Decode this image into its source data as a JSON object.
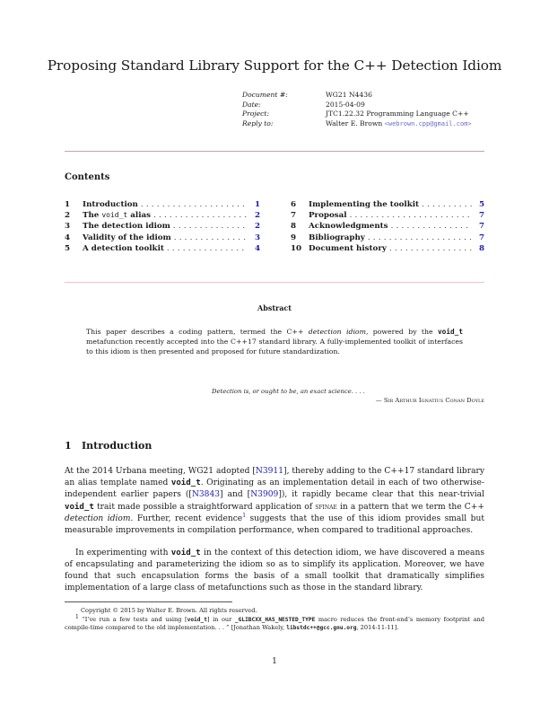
{
  "title": "Proposing Standard Library Support for the C++ Detection Idiom",
  "meta": [
    {
      "key": "Document #:",
      "value": "WG21 N4436"
    },
    {
      "key": "Date:",
      "value": "2015-04-09"
    },
    {
      "key": "Project:",
      "value": "JTC1.22.32 Programming Language C++"
    },
    {
      "key": "Reply to:",
      "value": "Walter E. Brown",
      "email": "<webrown.cpp@gmail.com>"
    }
  ],
  "contents": {
    "heading": "Contents",
    "left": [
      {
        "num": "1",
        "label": "Introduction",
        "page": "1"
      },
      {
        "num": "2",
        "label_pre": "The ",
        "label_code": "void_t",
        "label_post": " alias",
        "page": "2"
      },
      {
        "num": "3",
        "label": "The detection idiom",
        "page": "2"
      },
      {
        "num": "4",
        "label": "Validity of the idiom",
        "page": "3"
      },
      {
        "num": "5",
        "label": "A detection toolkit",
        "page": "4"
      }
    ],
    "right": [
      {
        "num": "6",
        "label": "Implementing the toolkit",
        "page": "5"
      },
      {
        "num": "7",
        "label": "Proposal",
        "page": "7"
      },
      {
        "num": "8",
        "label": "Acknowledgments",
        "page": "7"
      },
      {
        "num": "9",
        "label": "Bibliography",
        "page": "7"
      },
      {
        "num": "10",
        "label": "Document history",
        "page": "8"
      }
    ],
    "dots": "......................................"
  },
  "abstract": {
    "heading": "Abstract",
    "t1": "This paper describes a coding pattern, termed the C++ ",
    "t1_em": "detection idiom",
    "t2": ", powered by the ",
    "t2_code": "void_t",
    "t3": " metafunction recently accepted into the C++17 standard library. A fully-implemented toolkit of interfaces to this idiom is then presented and proposed for future standardization."
  },
  "epigraph": {
    "quote": "Detection is, or ought to be, an exact science. . . .",
    "attribution": "— Sir Arthur Ignatius Conan Doyle"
  },
  "section1": {
    "number": "1",
    "heading": "Introduction",
    "p1": {
      "a": "At the 2014 Urbana meeting, WG21 adopted [",
      "ref1": "N3911",
      "b": "], thereby adding to the C++17 standard library an alias template named ",
      "code1": "void_t",
      "c": ". Originating as an implementation detail in each of two otherwise-independent earlier papers ([",
      "ref2": "N3843",
      "d": "] and [",
      "ref3": "N3909",
      "e": "]), it rapidly became clear that this near-trivial ",
      "code2": "void_t",
      "f": " trait made possible a straightforward application of ",
      "sc": "sfinae",
      "g": " in a pattern that we term the C++ ",
      "em": "detection idiom",
      "h": ". Further, recent evidence",
      "sup": "1",
      "i": " suggests that the use of this idiom provides small but measurable improvements in compilation performance, when compared to traditional approaches."
    },
    "p2": {
      "a": "In experimenting with ",
      "code": "void_t",
      "b": " in the context of this detection idiom, we have discovered a means of encapsulating and parameterizing the idiom so as to simplify its application. Moreover, we have found that such encapsulation forms the basis of a small toolkit that dramatically simplifies implementation of a large class of metafunctions such as those in the standard library."
    }
  },
  "footnotes": {
    "copyright": "Copyright © 2015 by Walter E. Brown. All rights reserved.",
    "fn1_mark": "1",
    "fn1_a": " “I’ve run a few tests and using [",
    "fn1_code1": "void_t",
    "fn1_b": "] in our ",
    "fn1_code2": "_GLIBCXX_HAS_NESTED_TYPE",
    "fn1_c": " macro reduces the front-end’s memory footprint and compile-time compared to the old implementation. . . ” [Jonathan Wakely, ",
    "fn1_code3": "libstdc++@gcc.gnu.org",
    "fn1_d": ", 2014-11-11]."
  },
  "page_number": "1",
  "colors": {
    "link": "#1a1ab0",
    "email": "#6a6acf",
    "rule": "#c9a0a8"
  }
}
